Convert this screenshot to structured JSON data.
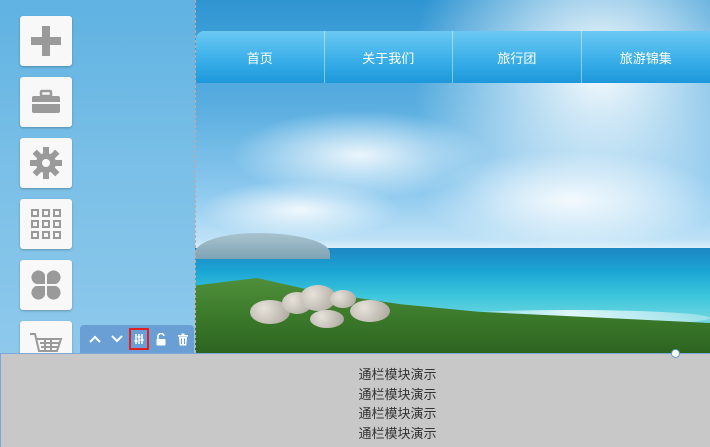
{
  "nav": {
    "items": [
      {
        "label": "首页"
      },
      {
        "label": "关于我们"
      },
      {
        "label": "旅行团"
      },
      {
        "label": "旅游锦集"
      }
    ]
  },
  "toolbar": {
    "items": [
      {
        "icon": "plus-icon"
      },
      {
        "icon": "toolbox-icon"
      },
      {
        "icon": "gear-icon"
      },
      {
        "icon": "grid-icon"
      },
      {
        "icon": "clover-icon"
      },
      {
        "icon": "cart-icon"
      }
    ],
    "icon_color": "#9a9a9a"
  },
  "module_controls": {
    "items": [
      {
        "icon": "chevron-up-icon"
      },
      {
        "icon": "chevron-down-icon"
      },
      {
        "icon": "settings-sliders-icon",
        "active": true
      },
      {
        "icon": "unlock-icon"
      },
      {
        "icon": "trash-icon"
      }
    ]
  },
  "module": {
    "lines": [
      "通栏模块演示",
      "通栏模块演示",
      "通栏模块演示",
      "通栏模块演示"
    ]
  },
  "colors": {
    "nav_gradient_top": "#6cc9f3",
    "nav_gradient_bottom": "#1d98db",
    "control_bar": "#6a9fd6",
    "active_outline": "#e02020",
    "module_bg": "#c8c8c8"
  }
}
